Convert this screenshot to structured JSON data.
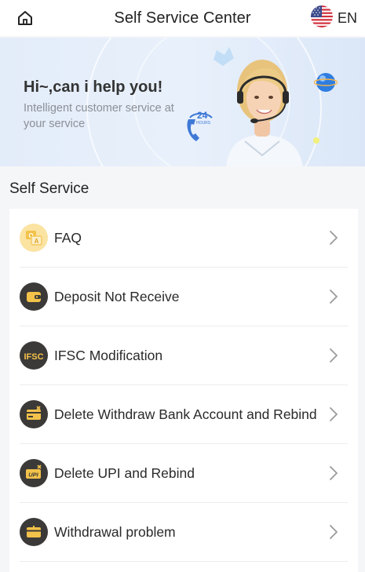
{
  "header": {
    "title": "Self Service Center",
    "language": "EN",
    "home_icon": "home-icon",
    "flag_icon": "us-flag-icon"
  },
  "banner": {
    "greeting": "Hi~,can i help you!",
    "subtitle": "Intelligent customer service at your service",
    "badge_number": "24",
    "badge_text": "HOURS"
  },
  "section": {
    "title": "Self Service"
  },
  "items": [
    {
      "label": "FAQ",
      "icon": "faq-chat-icon"
    },
    {
      "label": "Deposit Not Receive",
      "icon": "wallet-icon"
    },
    {
      "label": "IFSC Modification",
      "icon": "ifsc-icon",
      "icon_text": "IFSC"
    },
    {
      "label": "Delete Withdraw Bank Account and Rebind",
      "icon": "bank-card-delete-icon"
    },
    {
      "label": "Delete UPI and Rebind",
      "icon": "upi-delete-icon",
      "icon_text": "UPI"
    },
    {
      "label": "Withdrawal problem",
      "icon": "withdrawal-card-icon"
    }
  ],
  "colors": {
    "accent_gold": "#f2c24a",
    "icon_dark": "#3c3a38",
    "banner_bg": "#e6eef9",
    "chevron": "#9a9a9a"
  }
}
